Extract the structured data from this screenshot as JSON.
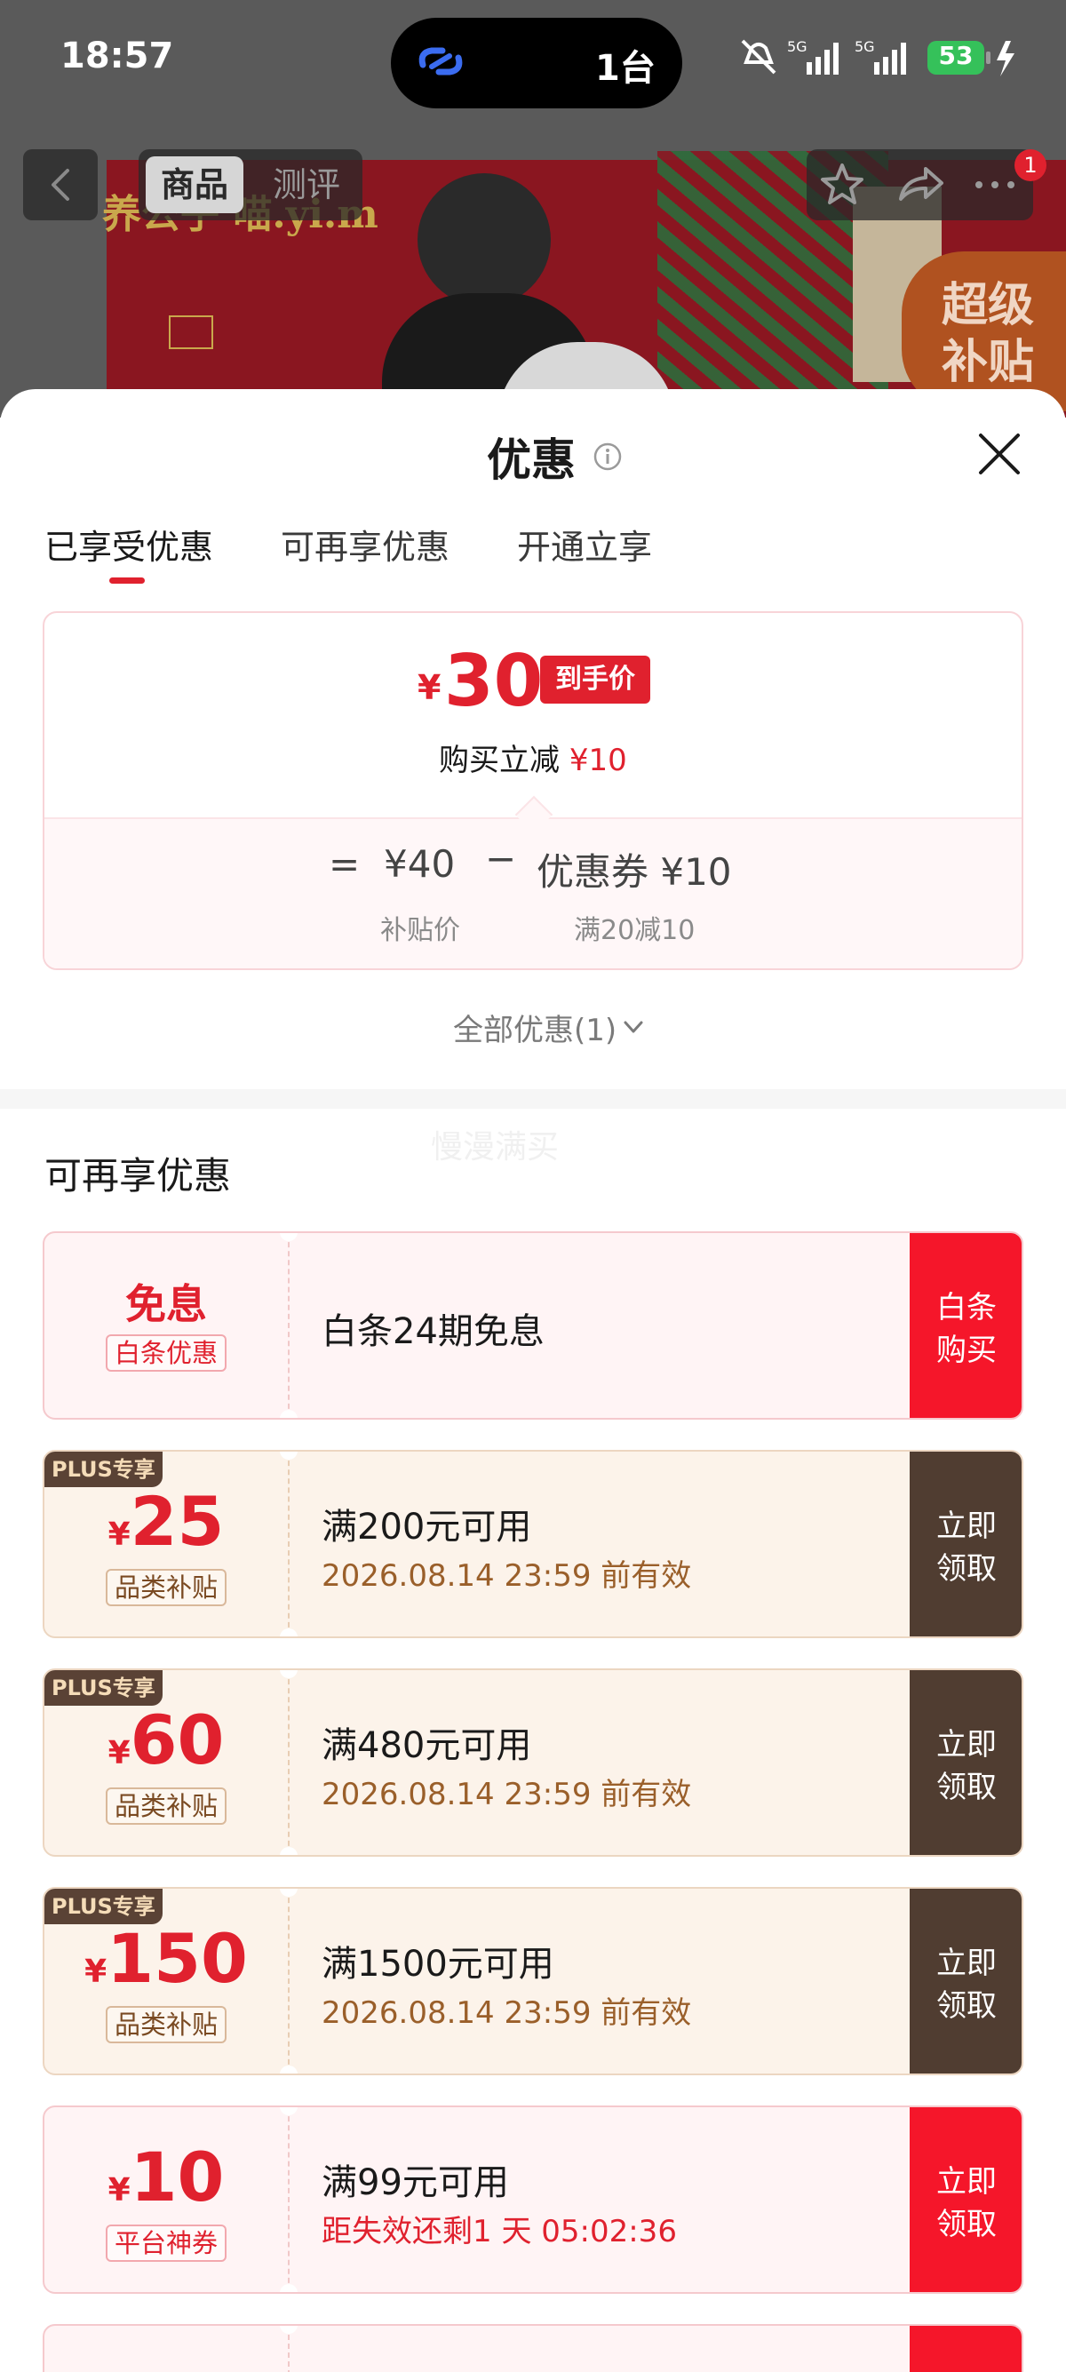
{
  "status_bar": {
    "time": "18:57",
    "island_text": "1台",
    "battery": "53"
  },
  "nav": {
    "tabs": [
      "商品",
      "测评"
    ],
    "badge": "1"
  },
  "banner": {
    "logo_text": "养公子 喵.yi.m",
    "super_badge": [
      "超级",
      "补贴"
    ]
  },
  "sheet": {
    "title": "优惠",
    "tabs": [
      "已享受优惠",
      "可再享优惠",
      "开通立享"
    ],
    "summary": {
      "currency": "¥",
      "final_price": "30",
      "final_tag": "到手价",
      "reduce_text": "购买立减",
      "reduce_amount": "¥10",
      "equals": "=",
      "base_price": "¥40",
      "minus": "−",
      "coupon_text": "优惠券 ¥10",
      "base_label": "补贴价",
      "coupon_label": "满20减10"
    },
    "all_discounts": "全部优惠(1)",
    "watermark": "慢漫满买",
    "section_title": "可再享优惠"
  },
  "coupons": [
    {
      "headline": "免息",
      "tag": "白条优惠",
      "condition": "白条24期免息",
      "action": [
        "白条",
        "购买"
      ]
    },
    {
      "plus_label": "PLUS专享",
      "currency": "¥",
      "amount": "25",
      "tag": "品类补贴",
      "condition": "满200元可用",
      "validity": "2026.08.14 23:59 前有效",
      "action": [
        "立即",
        "领取"
      ]
    },
    {
      "plus_label": "PLUS专享",
      "currency": "¥",
      "amount": "60",
      "tag": "品类补贴",
      "condition": "满480元可用",
      "validity": "2026.08.14 23:59 前有效",
      "action": [
        "立即",
        "领取"
      ]
    },
    {
      "plus_label": "PLUS专享",
      "currency": "¥",
      "amount": "150",
      "tag": "品类补贴",
      "condition": "满1500元可用",
      "validity": "2026.08.14 23:59 前有效",
      "action": [
        "立即",
        "领取"
      ]
    },
    {
      "currency": "¥",
      "amount": "10",
      "tag": "平台神券",
      "condition": "满99元可用",
      "validity": "距失效还剩1 天 05:02:36",
      "action": [
        "立即",
        "领取"
      ]
    }
  ],
  "colors": {
    "accent_red": "#e0212e",
    "plus_brown": "#503d31",
    "coupon_red_bg": "#fff4f5",
    "coupon_plus_bg": "#fcf3ea"
  }
}
